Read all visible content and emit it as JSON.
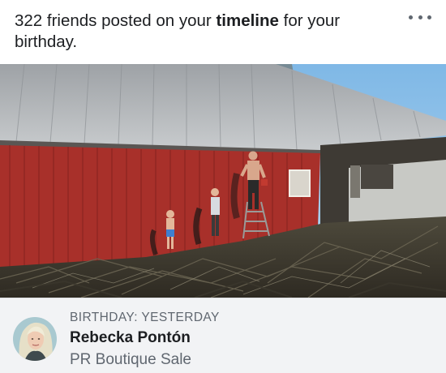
{
  "post": {
    "header_prefix": "322 friends posted on your ",
    "header_bold": "timeline",
    "header_suffix": " for your birthday."
  },
  "more_icon": "ellipsis-icon",
  "photo": {
    "description_icon": "photo"
  },
  "birthday": {
    "kicker": "BIRTHDAY: YESTERDAY",
    "name": "Rebecka Pontón",
    "subtitle": "PR Boutique Sale"
  },
  "colors": {
    "barn_red": "#a8302a",
    "roof": "#b9bcc0",
    "sky": "#8fc3e8",
    "footer_bg": "#f2f3f5"
  }
}
